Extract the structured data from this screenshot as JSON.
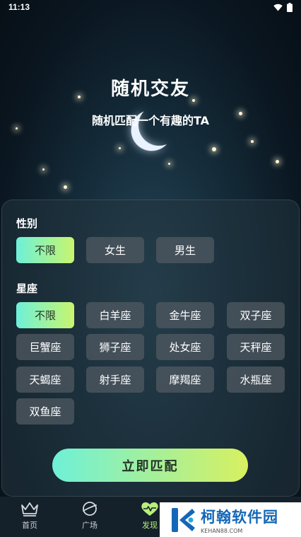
{
  "status_bar": {
    "time": "11:13"
  },
  "header": {
    "title": "随机交友",
    "subtitle": "随机匹配一个有趣的TA"
  },
  "filters": {
    "gender": {
      "label": "性别",
      "options": [
        "不限",
        "女生",
        "男生"
      ],
      "selected": "不限"
    },
    "zodiac": {
      "label": "星座",
      "options": [
        "不限",
        "白羊座",
        "金牛座",
        "双子座",
        "巨蟹座",
        "狮子座",
        "处女座",
        "天秤座",
        "天蝎座",
        "射手座",
        "摩羯座",
        "水瓶座",
        "双鱼座"
      ],
      "selected": "不限"
    }
  },
  "match_button": {
    "label": "立即匹配"
  },
  "tabbar": {
    "items": [
      {
        "label": "首页",
        "icon": "crown-icon"
      },
      {
        "label": "广场",
        "icon": "planet-icon"
      },
      {
        "label": "发现",
        "icon": "heart-pulse-icon",
        "active": true
      }
    ]
  },
  "watermark": {
    "title": "柯翰软件园",
    "url": "KEHAN88.COM"
  },
  "colors": {
    "accent_gradient_start": "#6ef0d8",
    "accent_gradient_end": "#c8f56e",
    "chip_bg": "#50595f",
    "watermark_blue": "#1467b8"
  }
}
